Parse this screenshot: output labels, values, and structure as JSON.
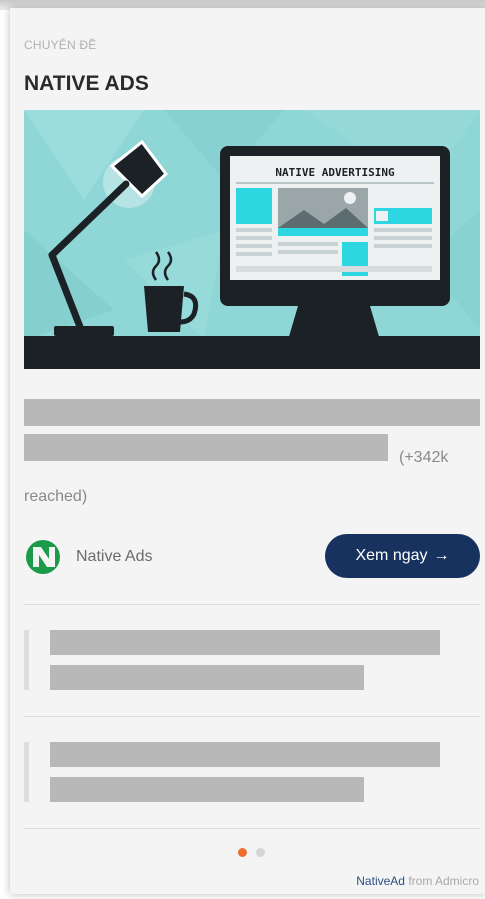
{
  "section": {
    "kicker": "CHUYÊN ĐỀ",
    "title": "NATIVE ADS"
  },
  "hero": {
    "monitor_heading": "NATIVE ADVERTISING",
    "colors": {
      "background": "#8fd6d6",
      "desk": "#1c2126",
      "accent": "#2dd6e0"
    }
  },
  "post": {
    "reach_label": "(+342k",
    "reach_label_cont": "reached)"
  },
  "brand": {
    "name": "Native Ads",
    "logo_color": "#1b9a4a"
  },
  "cta": {
    "label": "Xem ngay",
    "arrow": "→",
    "color": "#17325f"
  },
  "pagination": {
    "active_color": "#ec6b2d"
  },
  "footer": {
    "brand": "NativeAd",
    "suffix": "from Admicro"
  }
}
